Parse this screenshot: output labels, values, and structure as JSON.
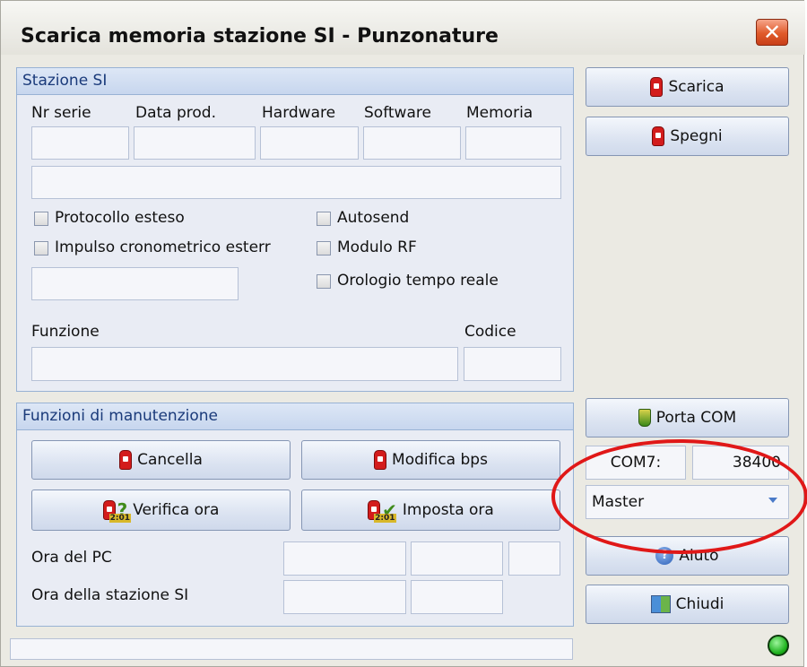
{
  "window": {
    "title": "Scarica memoria stazione SI - Punzonature",
    "close_label": "✕"
  },
  "stazione": {
    "header": "Stazione SI",
    "labels": {
      "nr_serie": "Nr serie",
      "data_prod": "Data prod.",
      "hardware": "Hardware",
      "software": "Software",
      "memoria": "Memoria"
    },
    "checkboxes": {
      "protocollo": "Protocollo esteso",
      "impulso": "Impulso cronometrico esterr",
      "autosend": "Autosend",
      "modulo_rf": "Modulo RF",
      "orologio": "Orologio tempo reale"
    },
    "funzione_label": "Funzione",
    "codice_label": "Codice"
  },
  "manutenzione": {
    "header": "Funzioni di manutenzione",
    "cancella": "Cancella",
    "modifica_bps": "Modifica bps",
    "verifica_ora": "Verifica ora",
    "imposta_ora": "Imposta ora",
    "ora_pc": "Ora del PC",
    "ora_stazione": "Ora della stazione SI",
    "clock_tag": "2:01"
  },
  "side": {
    "scarica": "Scarica",
    "spegni": "Spegni",
    "porta_com": "Porta COM",
    "com_port": "COM7:",
    "baud": "38400",
    "mode": "Master",
    "aiuto": "Aiuto",
    "chiudi": "Chiudi"
  },
  "colors": {
    "accent": "#98b2d4",
    "status_led": "#1db11d",
    "highlight_ellipse": "#e01818"
  },
  "icons": {
    "si_station": "si-station-icon",
    "question": "question-icon",
    "check": "check-icon",
    "com_plug": "plug-icon",
    "help": "help-icon",
    "exit": "exit-icon"
  }
}
